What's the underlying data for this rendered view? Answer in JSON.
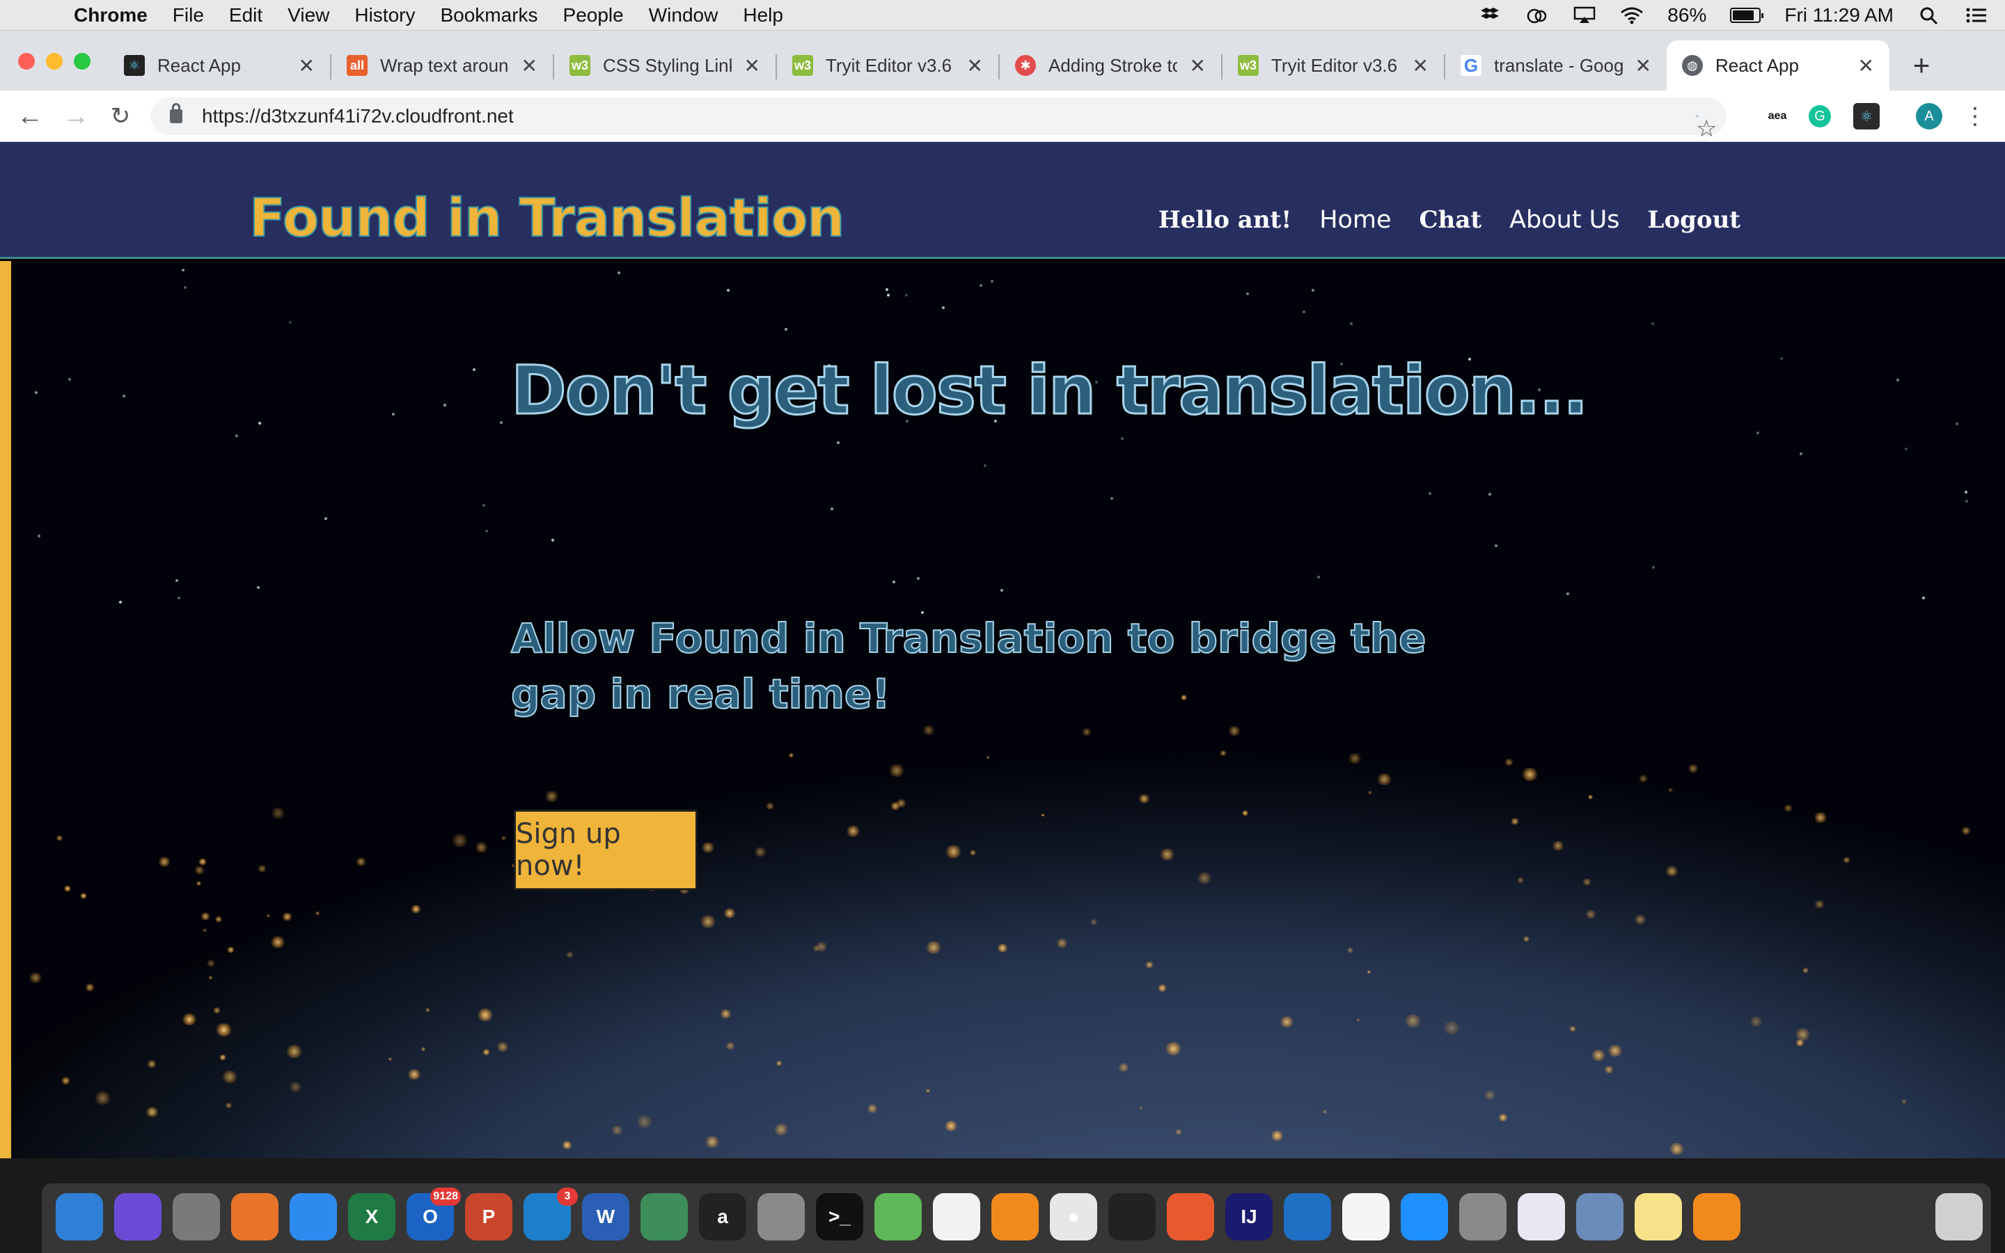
{
  "menubar": {
    "app": "Chrome",
    "items": [
      "File",
      "Edit",
      "View",
      "History",
      "Bookmarks",
      "People",
      "Window",
      "Help"
    ],
    "battery": "86%",
    "clock": "Fri 11:29 AM"
  },
  "tabs": [
    {
      "title": "React App",
      "favicon": "react-icon",
      "active": false
    },
    {
      "title": "Wrap text around",
      "favicon": "all-icon",
      "active": false
    },
    {
      "title": "CSS Styling Links",
      "favicon": "w3schools-icon",
      "active": false
    },
    {
      "title": "Tryit Editor v3.6",
      "favicon": "w3schools-icon",
      "active": false
    },
    {
      "title": "Adding Stroke to",
      "favicon": "stroke-icon",
      "active": false
    },
    {
      "title": "Tryit Editor v3.6",
      "favicon": "w3schools-icon",
      "active": false
    },
    {
      "title": "translate - Google",
      "favicon": "google-icon",
      "active": false
    },
    {
      "title": "React App",
      "favicon": "globe-icon",
      "active": true
    }
  ],
  "toolbar": {
    "url": "https://d3txzunf41i72v.cloudfront.net",
    "extensions": [
      "amazon-assistant-icon",
      "grammarly-icon",
      "react-devtools-icon"
    ],
    "profile_initial": "A"
  },
  "site": {
    "brand": "Found in Translation",
    "greeting": "Hello ant!",
    "nav": {
      "home": "Home",
      "chat": "Chat",
      "about": "About Us",
      "logout": "Logout"
    },
    "headline": "Don't get lost in translation...",
    "subline": "Allow Found in Translation to bridge the gap in real time!",
    "cta": "Sign up now!"
  },
  "dock": {
    "outlook_badge": "9128",
    "sourcetree_badge": "3",
    "apps": [
      "finder",
      "siri",
      "launchpad",
      "firefox",
      "safari",
      "excel",
      "outlook",
      "powerpoint",
      "sourcetree",
      "word",
      "network-utility",
      "amazon",
      "system-preferences",
      "terminal",
      "maps",
      "photos",
      "books",
      "chrome",
      "activity-monitor",
      "sketch",
      "intellij",
      "vscode",
      "slack",
      "messages",
      "keychain",
      "itunes",
      "preview",
      "notes",
      "cyberduck",
      "trash"
    ]
  },
  "colors": {
    "header_bg": "#272f61",
    "brand_yellow": "#efb43a",
    "brand_stroke": "#3f9aa3",
    "heading_fill": "#2b5f7b",
    "heading_stroke": "#a8d4ea"
  }
}
